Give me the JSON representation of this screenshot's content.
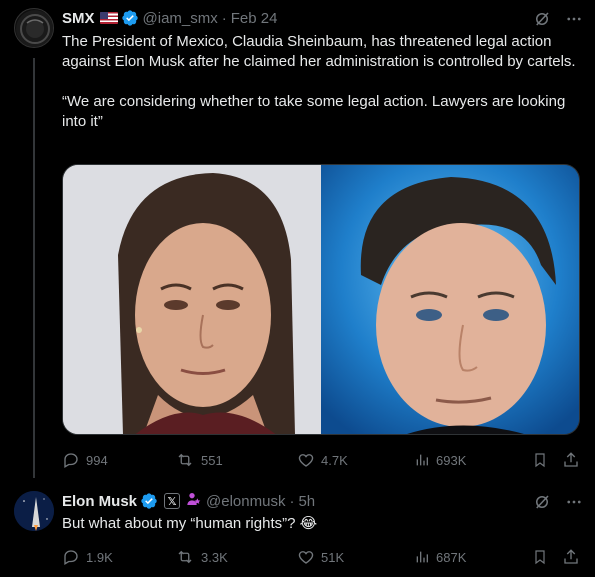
{
  "colors": {
    "background": "#000000",
    "text": "#e7e9ea",
    "muted": "#71767b",
    "verified": "#1d9bf0"
  },
  "tweet1": {
    "name": "SMX",
    "handle": "@iam_smx",
    "separator": "·",
    "date": "Feb 24",
    "text_line1": "The President of Mexico, Claudia Sheinbaum, has threatened legal action against Elon Musk after he claimed her administration is controlled by cartels.",
    "text_line2": "“We are considering whether to take some legal action. Lawyers are looking into it”",
    "stats": {
      "replies": "994",
      "reposts": "551",
      "likes": "4.7K",
      "views": "693K"
    }
  },
  "tweet2": {
    "name": "Elon Musk",
    "handle": "@elonmusk",
    "separator": "·",
    "time": "5h",
    "affiliate_badge": "𝕏",
    "text": "But what about my “human rights”? 😂",
    "stats": {
      "replies": "1.9K",
      "reposts": "3.3K",
      "likes": "51K",
      "views": "687K"
    }
  },
  "icons": [
    "grok-icon",
    "more-icon",
    "reply-icon",
    "repost-icon",
    "like-icon",
    "views-icon",
    "bookmark-icon",
    "share-icon",
    "verified-icon",
    "flag-us-icon"
  ]
}
